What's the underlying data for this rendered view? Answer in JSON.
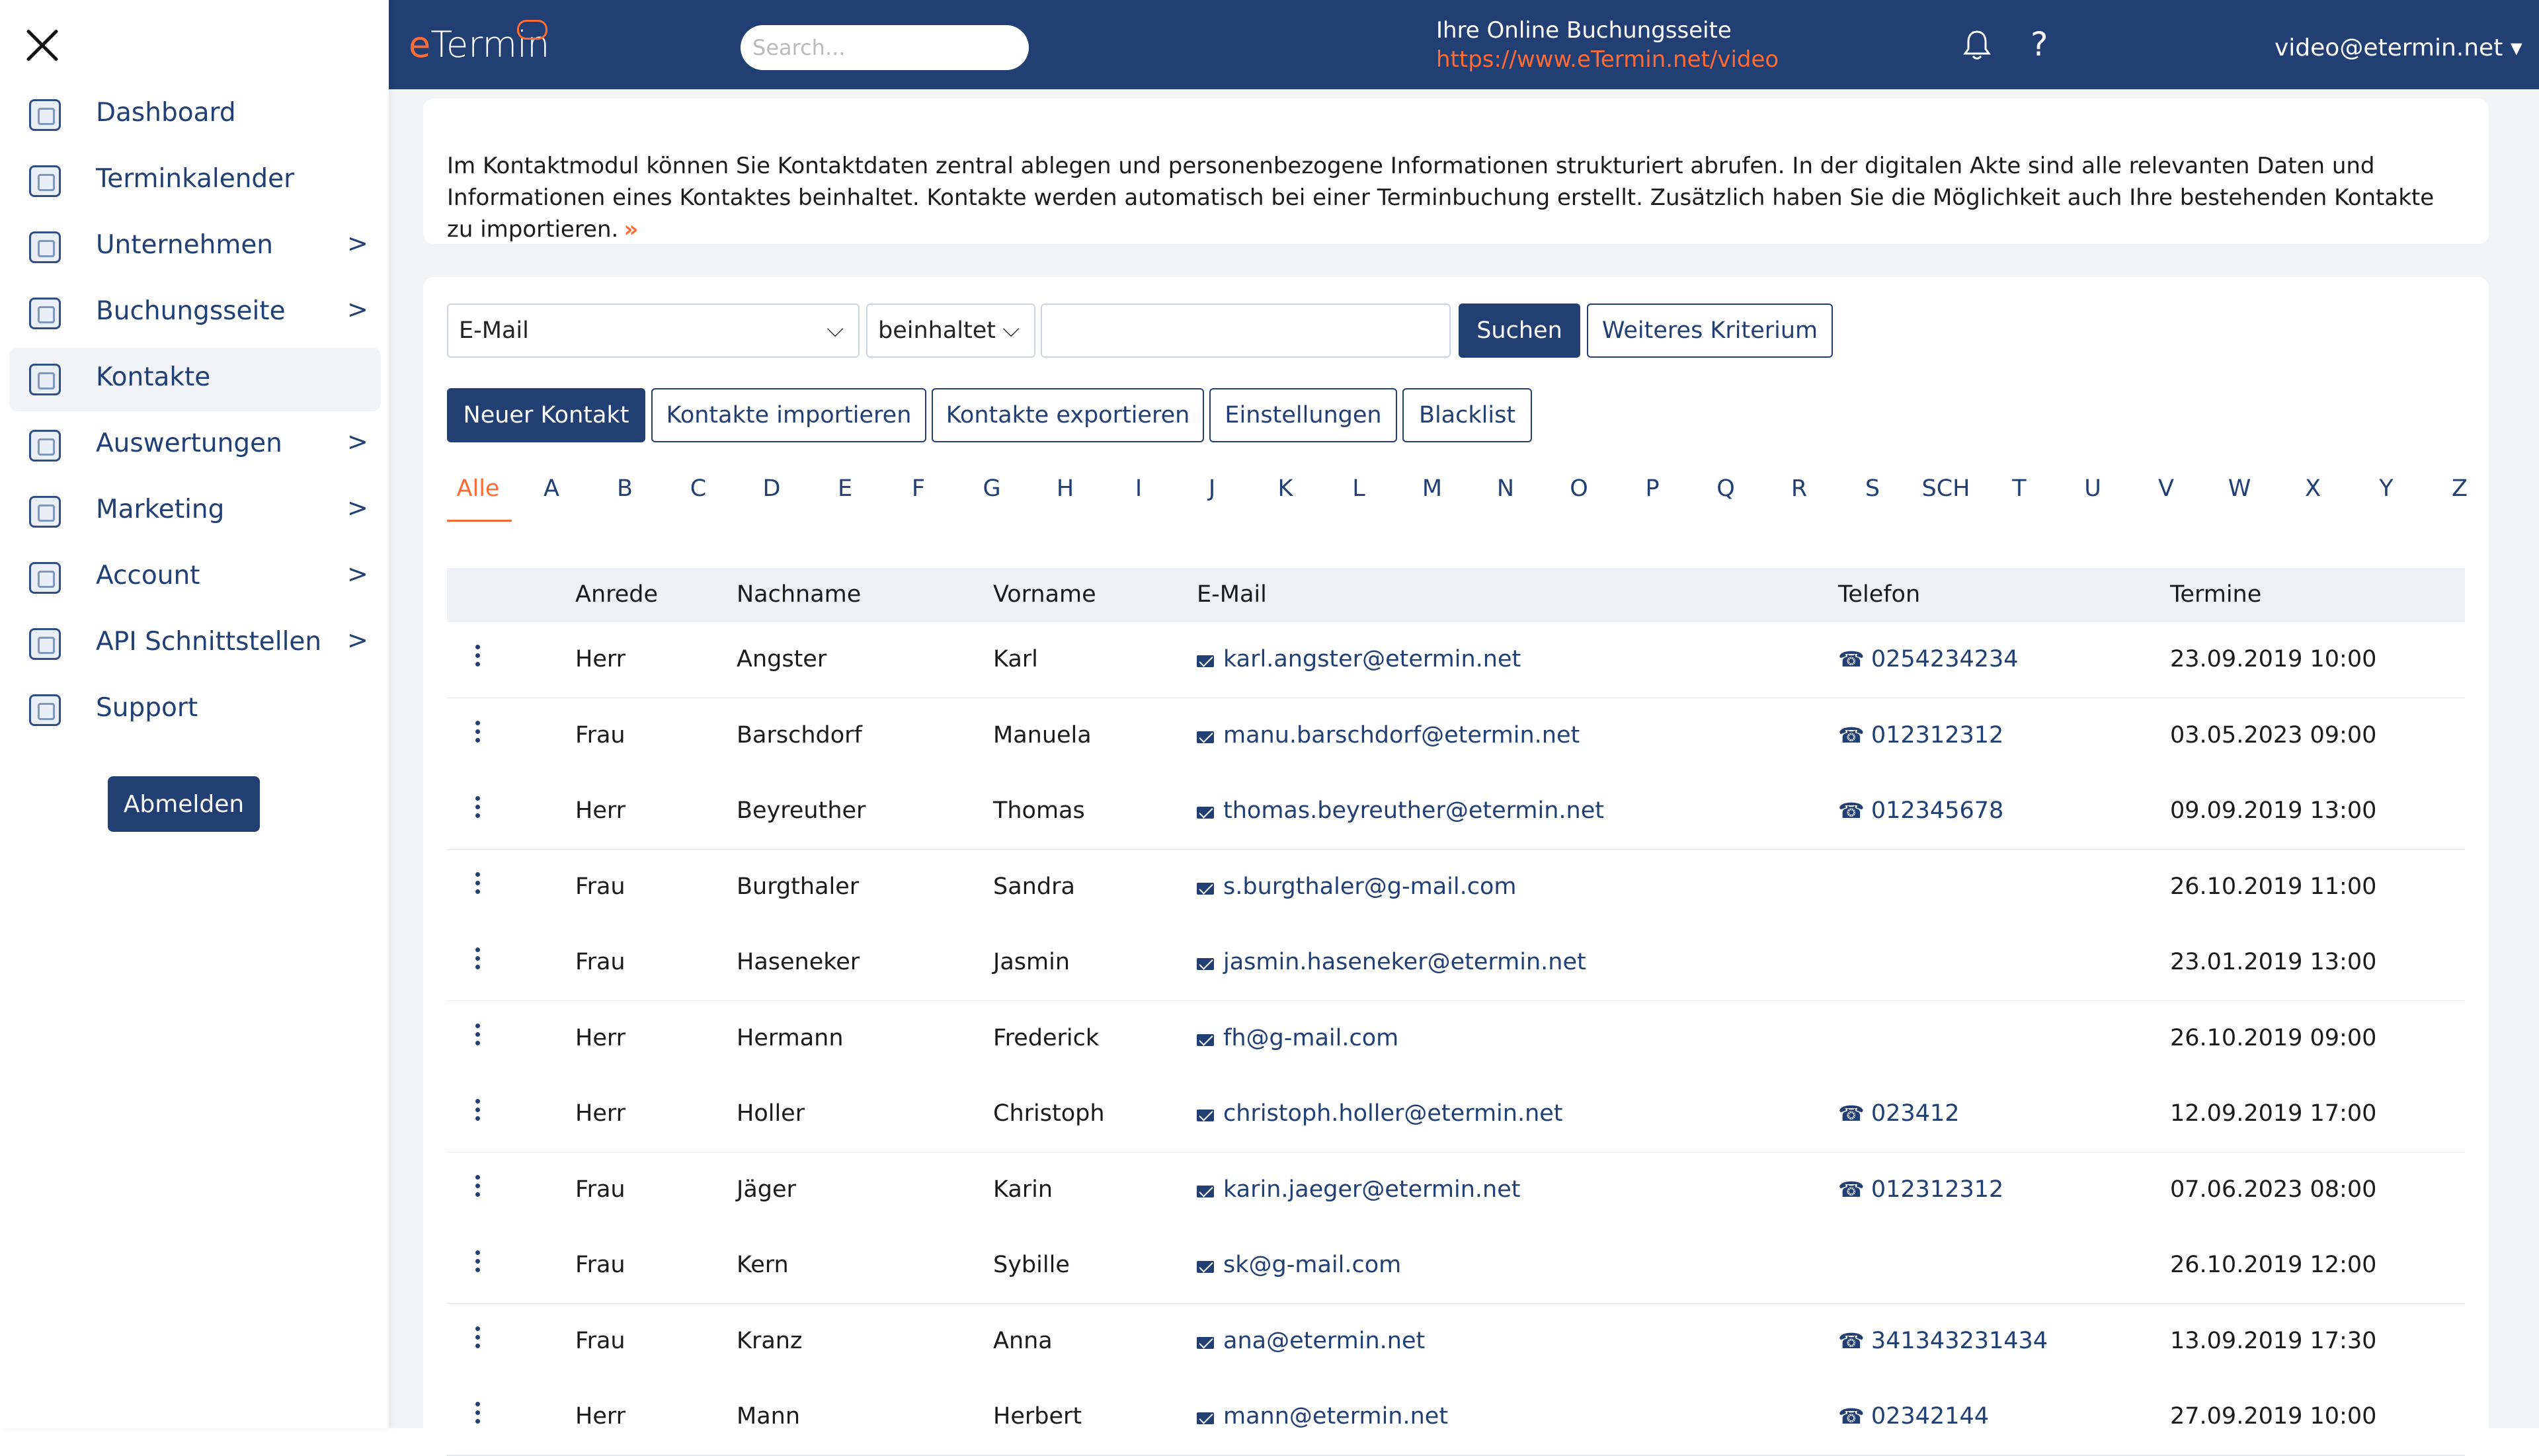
{
  "sidebar": {
    "close_label": "",
    "items": [
      {
        "label": "Dashboard",
        "arrow": "",
        "icon": "dashboard-icon"
      },
      {
        "label": "Terminkalender",
        "arrow": "",
        "icon": "calendar-icon"
      },
      {
        "label": "Unternehmen",
        "arrow": ">",
        "icon": "company-icon"
      },
      {
        "label": "Buchungsseite",
        "arrow": ">",
        "icon": "booking-page-icon"
      },
      {
        "label": "Kontakte",
        "arrow": "",
        "icon": "contacts-icon"
      },
      {
        "label": "Auswertungen",
        "arrow": ">",
        "icon": "analytics-icon"
      },
      {
        "label": "Marketing",
        "arrow": ">",
        "icon": "marketing-icon"
      },
      {
        "label": "Account",
        "arrow": ">",
        "icon": "account-icon"
      },
      {
        "label": "API Schnittstellen",
        "arrow": ">",
        "icon": "api-icon"
      },
      {
        "label": "Support",
        "arrow": "",
        "icon": "support-icon"
      }
    ],
    "active_index": 4,
    "logout_label": "Abmelden"
  },
  "header": {
    "logo_e": "e",
    "logo_rest": "Termin",
    "search_placeholder": "Search...",
    "booking_title": "Ihre Online Buchungsseite",
    "booking_url": "https://www.eTermin.net/video",
    "help_label": "?",
    "user_label": "video@etermin.net ▾"
  },
  "info": {
    "text": "Im Kontaktmodul können Sie Kontaktdaten zentral ablegen und personenbezogene Informationen strukturiert abrufen. In der digitalen Akte sind alle relevanten Daten und Informationen eines Kontaktes beinhaltet. Kontakte werden automatisch bei einer Terminbuchung erstellt. Zusätzlich haben Sie die Möglichkeit auch Ihre bestehenden Kontakte zu importieren.",
    "expand_icon": "»"
  },
  "filter": {
    "field_value": "E-Mail",
    "operator_value": "beinhaltet",
    "search_label": "Suchen",
    "more_label": "Weiteres Kriterium",
    "chevron": "⌵"
  },
  "actions": {
    "new_contact": "Neuer Kontakt",
    "import": "Kontakte importieren",
    "export": "Kontakte exportieren",
    "settings": "Einstellungen",
    "blacklist": "Blacklist"
  },
  "alphabet": [
    "Alle",
    "A",
    "B",
    "C",
    "D",
    "E",
    "F",
    "G",
    "H",
    "I",
    "J",
    "K",
    "L",
    "M",
    "N",
    "O",
    "P",
    "Q",
    "R",
    "S",
    "SCH",
    "T",
    "U",
    "V",
    "W",
    "X",
    "Y",
    "Z"
  ],
  "table": {
    "headers": {
      "salutation": "Anrede",
      "last_name": "Nachname",
      "first_name": "Vorname",
      "email": "E-Mail",
      "phone": "Telefon",
      "appointments": "Termine"
    },
    "rows": [
      {
        "salutation": "Herr",
        "last_name": "Angster",
        "first_name": "Karl",
        "email": "karl.angster@etermin.net",
        "phone": "0254234234",
        "appointment": "23.09.2019 10:00"
      },
      {
        "salutation": "Frau",
        "last_name": "Barschdorf",
        "first_name": "Manuela",
        "email": "manu.barschdorf@etermin.net",
        "phone": "012312312",
        "appointment": "03.05.2023 09:00"
      },
      {
        "salutation": "Herr",
        "last_name": "Beyreuther",
        "first_name": "Thomas",
        "email": "thomas.beyreuther@etermin.net",
        "phone": "012345678",
        "appointment": "09.09.2019 13:00"
      },
      {
        "salutation": "Frau",
        "last_name": "Burgthaler",
        "first_name": "Sandra",
        "email": "s.burgthaler@g-mail.com",
        "phone": "",
        "appointment": "26.10.2019 11:00"
      },
      {
        "salutation": "Frau",
        "last_name": "Haseneker",
        "first_name": "Jasmin",
        "email": "jasmin.haseneker@etermin.net",
        "phone": "",
        "appointment": "23.01.2019 13:00"
      },
      {
        "salutation": "Herr",
        "last_name": "Hermann",
        "first_name": "Frederick",
        "email": "fh@g-mail.com",
        "phone": "",
        "appointment": "26.10.2019 09:00"
      },
      {
        "salutation": "Herr",
        "last_name": "Holler",
        "first_name": "Christoph",
        "email": "christoph.holler@etermin.net",
        "phone": "023412",
        "appointment": "12.09.2019 17:00"
      },
      {
        "salutation": "Frau",
        "last_name": "Jäger",
        "first_name": "Karin",
        "email": "karin.jaeger@etermin.net",
        "phone": "012312312",
        "appointment": "07.06.2023 08:00"
      },
      {
        "salutation": "Frau",
        "last_name": "Kern",
        "first_name": "Sybille",
        "email": "sk@g-mail.com",
        "phone": "",
        "appointment": "26.10.2019 12:00"
      },
      {
        "salutation": "Frau",
        "last_name": "Kranz",
        "first_name": "Anna",
        "email": "ana@etermin.net",
        "phone": "341343231434",
        "appointment": "13.09.2019 17:30"
      },
      {
        "salutation": "Herr",
        "last_name": "Mann",
        "first_name": "Herbert",
        "email": "mann@etermin.net",
        "phone": "02342144",
        "appointment": "27.09.2019 10:00"
      }
    ]
  },
  "colors": {
    "brand": "#223f73",
    "accent": "#ff6b35",
    "background": "#f3f4f6"
  }
}
